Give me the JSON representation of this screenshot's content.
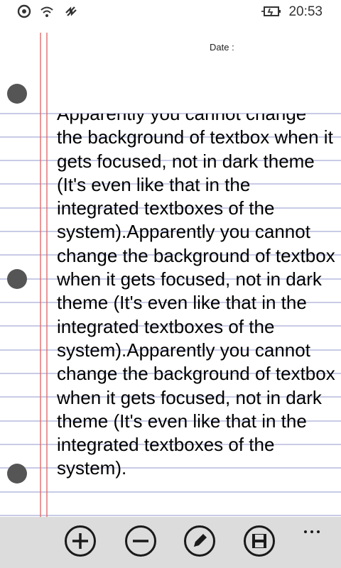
{
  "status_bar": {
    "time": "20:53",
    "icons": [
      "sync-icon",
      "wifi-icon",
      "data-icon",
      "battery-charging-icon"
    ]
  },
  "notebook": {
    "date_label": "Date :",
    "note_text": "Apparently you cannot change the background of textbox when it gets focused, not in dark theme (It's even like that in the integrated textboxes of the system).Apparently you cannot change the background of textbox when it gets focused, not in dark theme (It's even like that in the integrated textboxes of the system).Apparently you cannot change the background of textbox when it gets focused, not in dark theme (It's even like that in the integrated textboxes of the system)."
  },
  "app_bar": {
    "buttons": [
      "add-icon",
      "remove-icon",
      "edit-icon",
      "save-icon"
    ],
    "more_icon": "more-dots-icon"
  },
  "colors": {
    "rule_line": "#a7acd8",
    "margin_line": "#e06b6b",
    "hole": "#555555",
    "app_bar_bg": "#dcdcdc"
  }
}
